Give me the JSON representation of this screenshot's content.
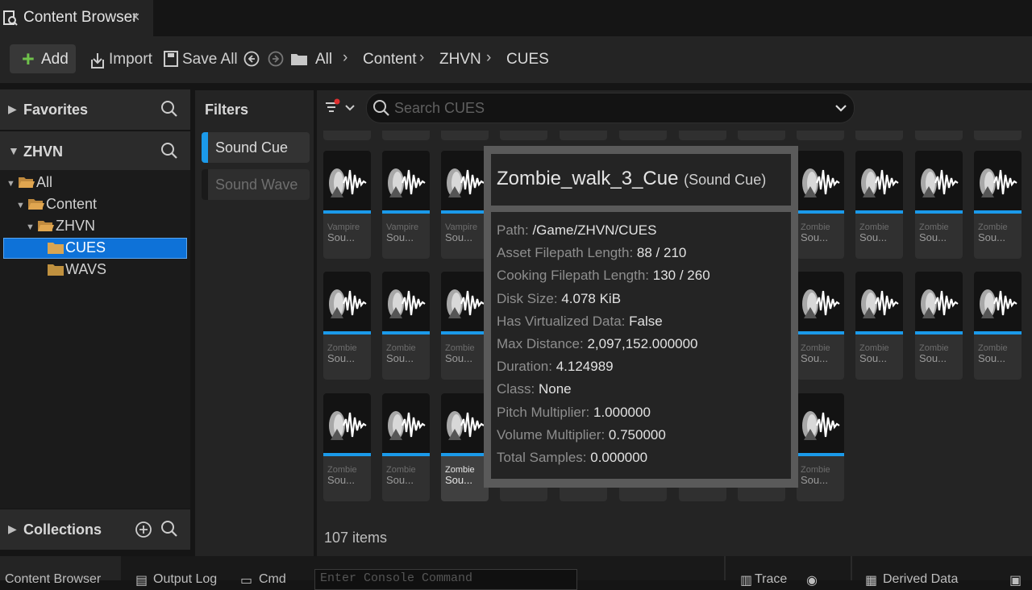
{
  "window_tab": {
    "title": "Content Browser",
    "close_glyph": "×"
  },
  "toolbar": {
    "add_label": "Add",
    "import_label": "Import",
    "save_all_label": "Save All",
    "breadcrumb": [
      "All",
      "Content",
      "ZHVN",
      "CUES"
    ]
  },
  "left_panel": {
    "favorites_label": "Favorites",
    "project_label": "ZHVN",
    "tree": [
      "All",
      "Content",
      "ZHVN",
      "CUES",
      "WAVS"
    ],
    "selected_folder": "CUES",
    "collections_label": "Collections"
  },
  "filters": {
    "title": "Filters",
    "items": [
      {
        "label": "Sound Cue",
        "active": true,
        "color": "#1b9aea"
      },
      {
        "label": "Sound Wave",
        "active": false,
        "color": "#1a1a1a"
      }
    ]
  },
  "search": {
    "placeholder": "Search CUES"
  },
  "assets": {
    "row1": [
      {
        "line1": "Vampire",
        "line2": "Sou..."
      },
      {
        "line1": "Vampire",
        "line2": "Sou..."
      },
      {
        "line1": "Vampire",
        "line2": "Sou..."
      },
      {
        "line1": "Zombie",
        "line2": "Sou..."
      },
      {
        "line1": "Zombie",
        "line2": "Sou..."
      },
      {
        "line1": "Zombie",
        "line2": "Sou..."
      },
      {
        "line1": "Zombie",
        "line2": "Sou..."
      }
    ],
    "row2": [
      {
        "line1": "Zombie",
        "line2": "Sou..."
      },
      {
        "line1": "Zombie",
        "line2": "Sou..."
      },
      {
        "line1": "Zombie",
        "line2": "Sou..."
      },
      {
        "line1": "Zombie",
        "line2": "Sou..."
      },
      {
        "line1": "Zombie",
        "line2": "Sou..."
      },
      {
        "line1": "Zombie",
        "line2": "Sou..."
      },
      {
        "line1": "Zombie",
        "line2": "Sou..."
      }
    ],
    "row3": [
      {
        "line1": "Zombie",
        "line2": "Sou..."
      },
      {
        "line1": "Zombie",
        "line2": "Sou..."
      },
      {
        "line1": "Zombie",
        "line2": "Sou...",
        "hover": true
      },
      {
        "line1": "Zombie",
        "line2": "Sou..."
      }
    ],
    "count_text": "107 items"
  },
  "tooltip": {
    "name": "Zombie_walk_3_Cue",
    "type": "(Sound Cue)",
    "props": [
      {
        "key": "Path:",
        "value": "/Game/ZHVN/CUES"
      },
      {
        "key": "Asset Filepath Length:",
        "value": "88 / 210"
      },
      {
        "key": "Cooking Filepath Length:",
        "value": "130 / 260"
      },
      {
        "key": "Disk Size:",
        "value": "4.078 KiB"
      },
      {
        "key": "Has Virtualized Data:",
        "value": "False"
      },
      {
        "key": "Max Distance:",
        "value": "2,097,152.000000"
      },
      {
        "key": "Duration:",
        "value": "4.124989"
      },
      {
        "key": "Class:",
        "value": "None"
      },
      {
        "key": "Pitch Multiplier:",
        "value": "1.000000"
      },
      {
        "key": "Volume Multiplier:",
        "value": "0.750000"
      },
      {
        "key": "Total Samples:",
        "value": "0.000000"
      }
    ]
  },
  "bottombar": {
    "content_browser": "Content Browser",
    "output_log": "Output Log",
    "cmd": "Cmd",
    "console_placeholder": "Enter Console Command",
    "trace": "Trace",
    "derived_data": "Derived Data"
  }
}
